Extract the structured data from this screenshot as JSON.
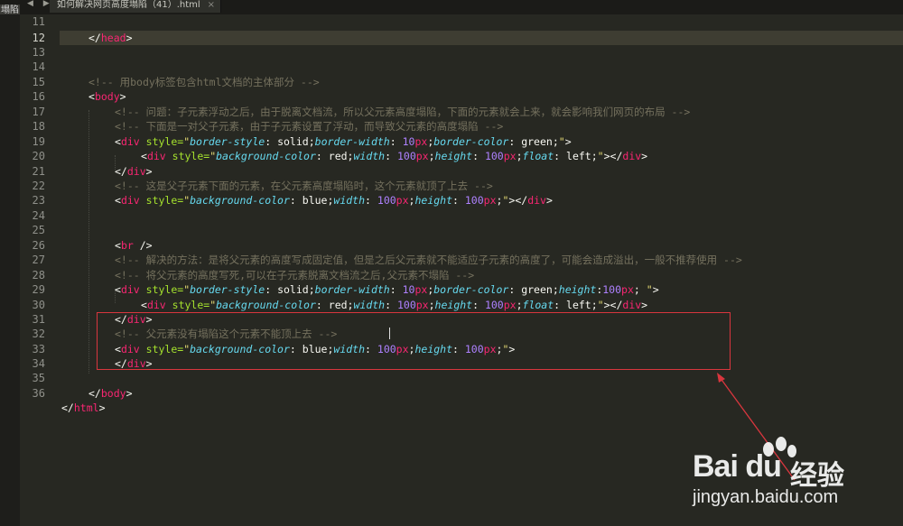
{
  "tabs": {
    "side_tab_label": "塌陷",
    "nav_arrows": "◀ ▶",
    "file_tab_label": "如何解决网页高度塌陷（41）.html",
    "close_label": "×"
  },
  "editor": {
    "active_line": 12,
    "line_numbers": [
      "11",
      "12",
      "13",
      "14",
      "15",
      "16",
      "17",
      "18",
      "19",
      "20",
      "21",
      "22",
      "23",
      "24",
      "25",
      "26",
      "27",
      "28",
      "29",
      "30",
      "31",
      "32",
      "33",
      "34",
      "35",
      "36"
    ],
    "lines": {
      "l12": "</head>",
      "l15": "<!-- 用body标签包含html文档的主体部分 -->",
      "l16": "<body>",
      "l17": "<!-- 问题：子元素浮动之后，由于脱离文档流，所以父元素高度塌陷，下面的元素就会上来，就会影响我们网页的布局 -->",
      "l18": "<!-- 下面是一对父子元素，由于子元素设置了浮动，而导致父元素的高度塌陷 -->",
      "l22": "<!-- 这是父子元素下面的元素，在父元素高度塌陷时，这个元素就顶了上去 -->",
      "l26": "<!-- 解决的方法：是将父元素的高度写成固定值，但是之后父元素就不能适应子元素的高度了，可能会造成溢出，一般不推荐使用 -->",
      "l27": "<!-- 将父元素的高度写死,可以在子元素脱离文档流之后,父元素不塌陷 -->",
      "l31": "<!-- 父元素没有塌陷这个元素不能顶上去 -->",
      "l35": "</body>",
      "l36": "</html>"
    },
    "tokens": {
      "lt": "<",
      "gt": ">",
      "close_lt": "</",
      "div": "div",
      "br": "br",
      "style_attr": " style=",
      "q": "\"",
      "semi": ";",
      "colon": ": ",
      "colon_nospace": ":",
      "border_style": "border-style",
      "border_width": "border-width",
      "border_color": "border-color",
      "background_color": "background-color",
      "width": "width",
      "height": "height",
      "float": "float",
      "solid": "solid",
      "ten": "10",
      "hundred": "100",
      "px": "px",
      "green": "green",
      "red": "red",
      "blue": "blue",
      "left": "left",
      "br_tail": " />",
      "space_then_quote": " \""
    }
  },
  "annotation": {
    "box_color": "#d9363e",
    "arrow_color": "#d9363e"
  },
  "watermark": {
    "brand": "Bai du",
    "cn": "经验",
    "url": "jingyan.baidu.com"
  },
  "colors": {
    "background": "#272822",
    "comment": "#75715e",
    "tag": "#f92672",
    "attribute": "#a6e22e",
    "string": "#e6db74",
    "property": "#66d9ef",
    "number": "#ae81ff"
  }
}
